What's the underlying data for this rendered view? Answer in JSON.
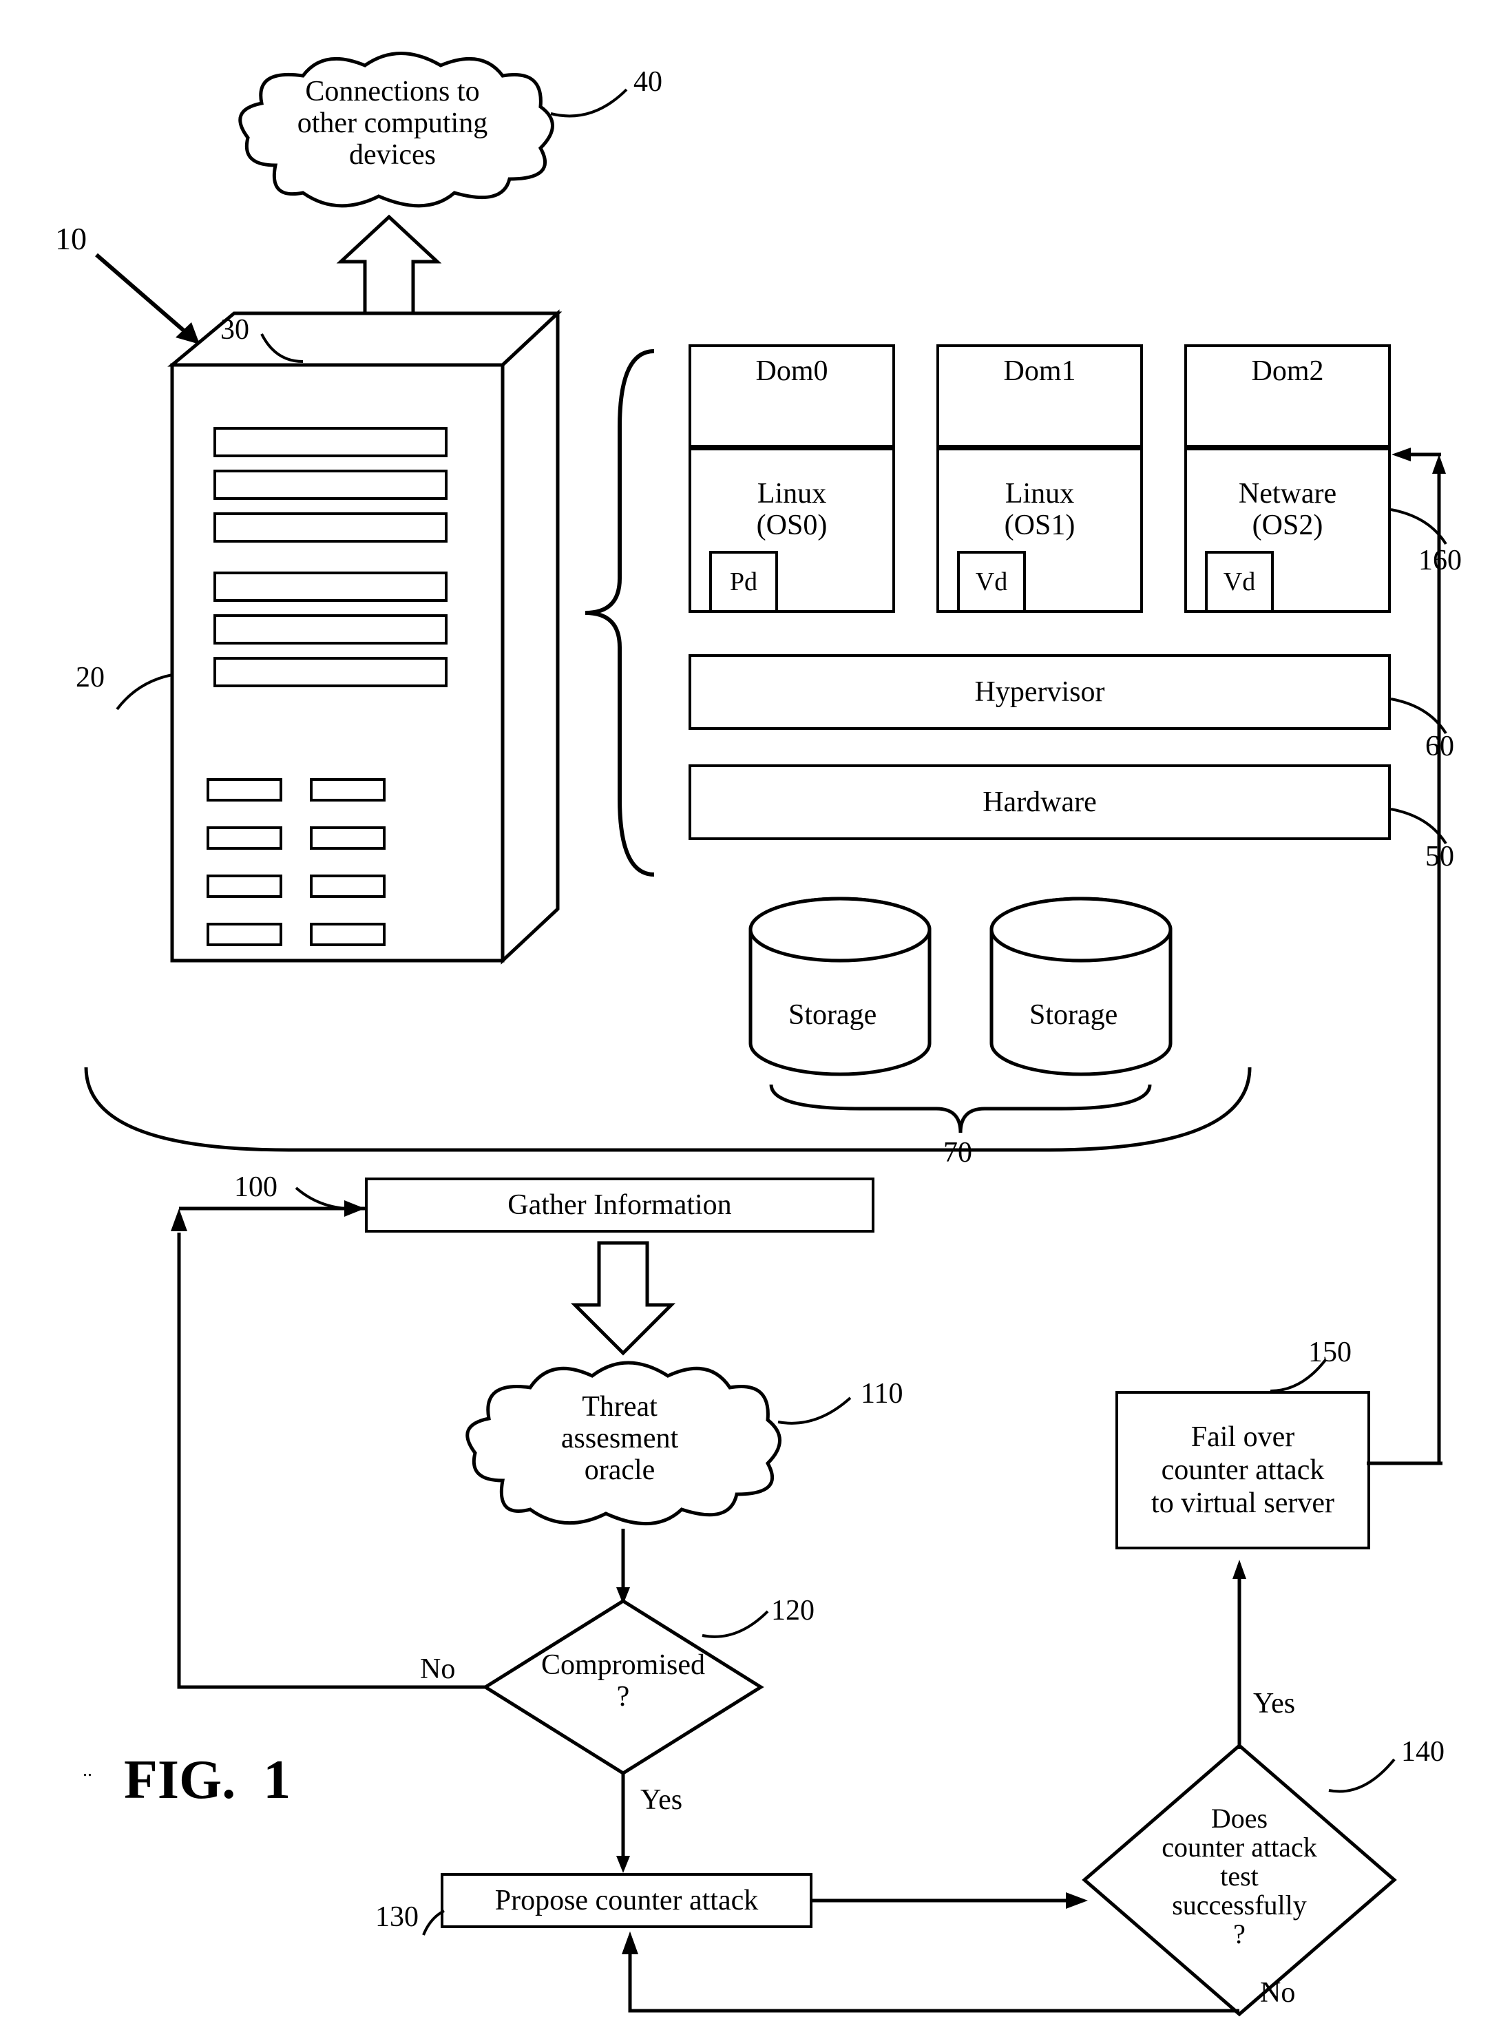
{
  "figure_label": "FIG.  1",
  "refs": {
    "r10": "10",
    "r20": "20",
    "r30": "30",
    "r40": "40",
    "r50": "50",
    "r60": "60",
    "r70": "70",
    "r100": "100",
    "r110": "110",
    "r120": "120",
    "r130": "130",
    "r140": "140",
    "r150": "150",
    "r160": "160"
  },
  "cloud_top": "Connections to\nother computing\ndevices",
  "dom0": {
    "title": "Dom0",
    "os": "Linux\n(OS0)",
    "drv": "Pd"
  },
  "dom1": {
    "title": "Dom1",
    "os": "Linux\n(OS1)",
    "drv": "Vd"
  },
  "dom2": {
    "title": "Dom2",
    "os": "Netware\n(OS2)",
    "drv": "Vd"
  },
  "hypervisor": "Hypervisor",
  "hardware": "Hardware",
  "storage": "Storage",
  "flow": {
    "gather": "Gather Information",
    "threat": "Threat\nassesment\noracle",
    "compromised": "Compromised\n?",
    "propose": "Propose counter attack",
    "test": "Does\ncounter attack\ntest\nsuccessfully\n?",
    "failover": "Fail over\ncounter attack\nto virtual server",
    "yes": "Yes",
    "no": "No"
  }
}
